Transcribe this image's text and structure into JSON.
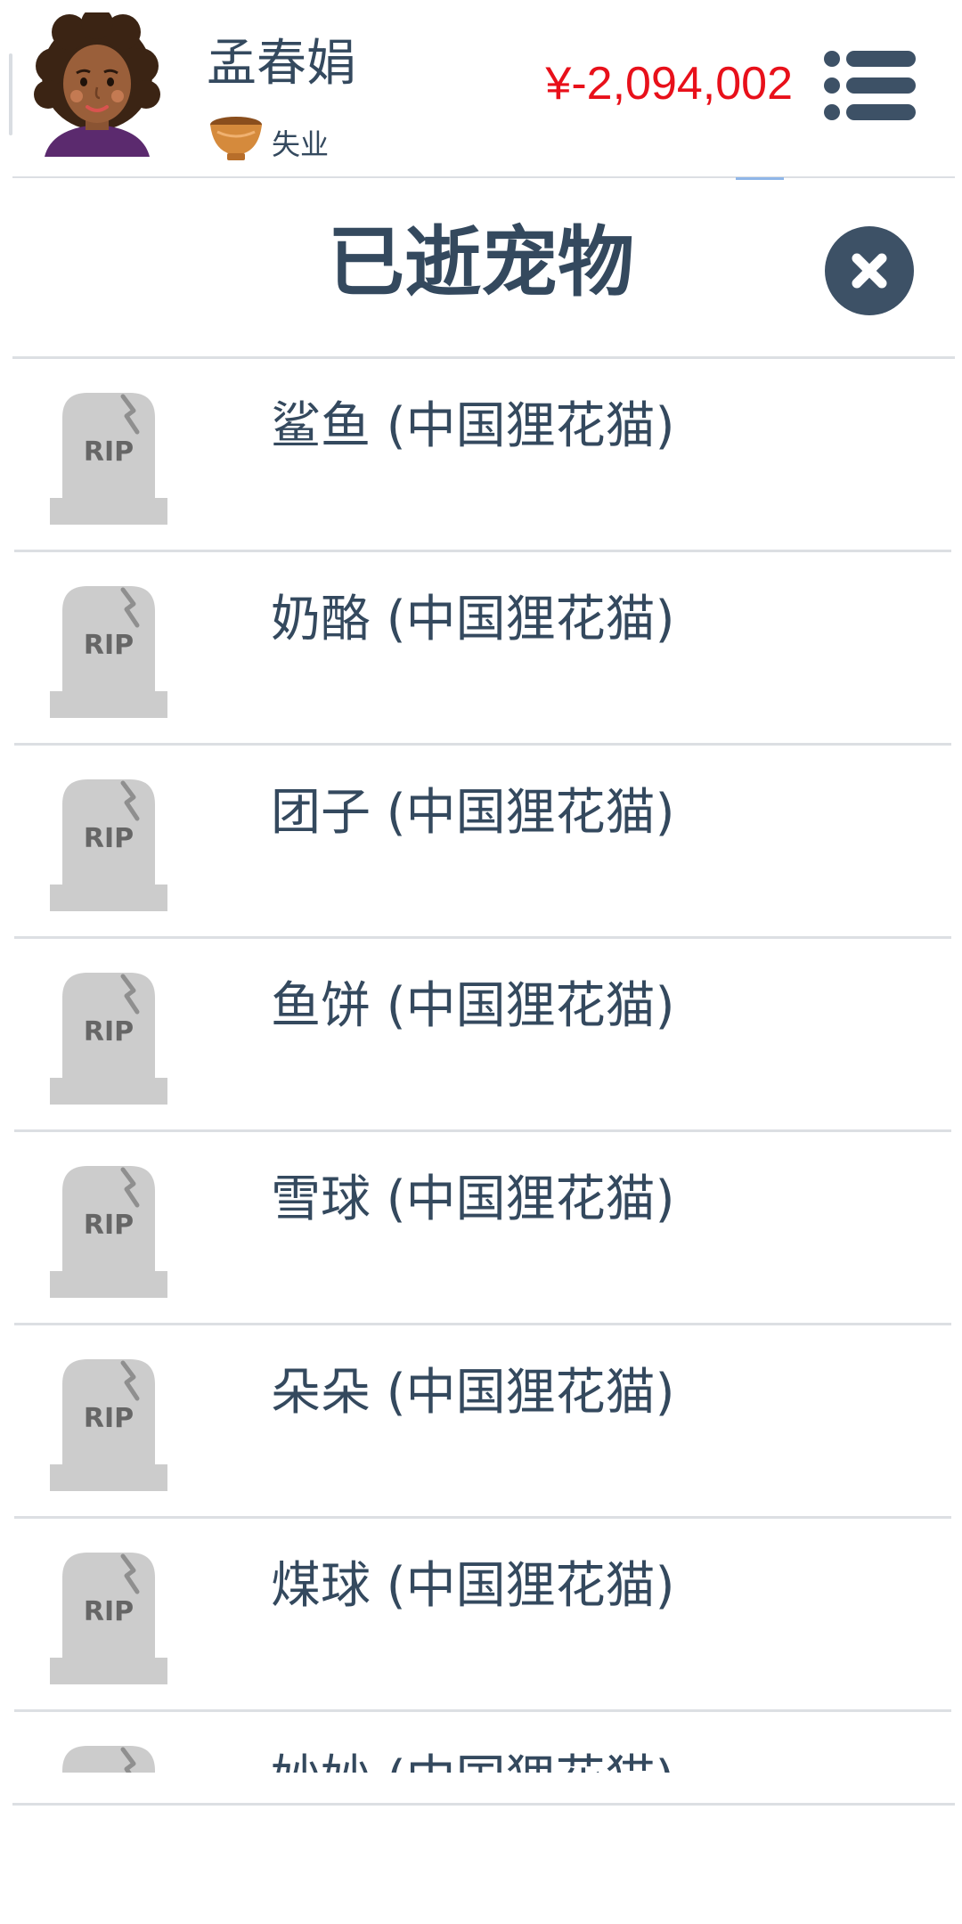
{
  "header": {
    "player_name": "孟春娟",
    "job": "失业",
    "money": "¥-2,094,002",
    "money_color": "#e8101a",
    "avatar_icon": "avatar-curly-hair-woman",
    "job_icon": "bowl-icon",
    "menu_icon": "hamburger-menu-icon"
  },
  "dialog": {
    "title": "已逝宠物",
    "close_icon": "close-icon"
  },
  "pets": [
    {
      "label": "鲨鱼 (中国狸花猫)",
      "icon": "rip-tombstone-icon"
    },
    {
      "label": "奶酪 (中国狸花猫)",
      "icon": "rip-tombstone-icon"
    },
    {
      "label": "团子 (中国狸花猫)",
      "icon": "rip-tombstone-icon"
    },
    {
      "label": "鱼饼 (中国狸花猫)",
      "icon": "rip-tombstone-icon"
    },
    {
      "label": "雪球 (中国狸花猫)",
      "icon": "rip-tombstone-icon"
    },
    {
      "label": "朵朵 (中国狸花猫)",
      "icon": "rip-tombstone-icon"
    },
    {
      "label": "煤球 (中国狸花猫)",
      "icon": "rip-tombstone-icon"
    },
    {
      "label": "妙妙 (中国狸花猫)",
      "icon": "rip-tombstone-icon"
    }
  ],
  "tombstone_text": "RIP",
  "colors": {
    "text": "#34495e",
    "accent_dark": "#3d5166",
    "tombstone": "#cccccc",
    "tombstone_text": "#666666",
    "divider": "#dcdfe3"
  }
}
